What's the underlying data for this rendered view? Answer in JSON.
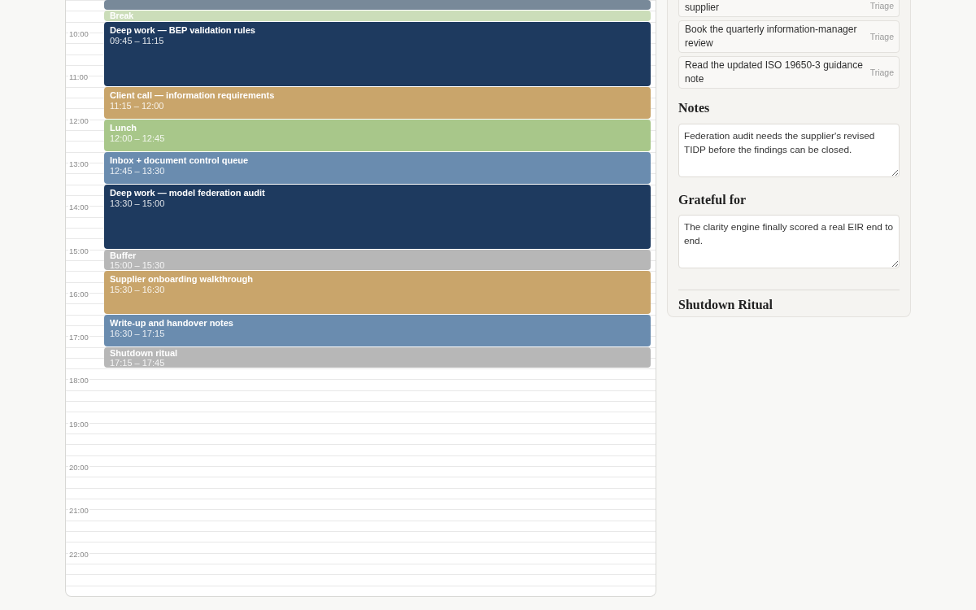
{
  "calendar": {
    "hours": [
      "10:00",
      "11:00",
      "12:00",
      "13:00",
      "14:00",
      "15:00",
      "16:00",
      "17:00",
      "18:00",
      "19:00",
      "20:00",
      "21:00",
      "22:00"
    ],
    "events": [
      {
        "color": "#788999"
      },
      {
        "title": "Break",
        "color": "#cbddb9"
      },
      {
        "title": "Deep work — BEP validation rules",
        "time": "09:45 – 11:15",
        "color": "#1e3a5f"
      },
      {
        "title": "Client call — information requirements",
        "time": "11:15 – 12:00",
        "color": "#c9a56b"
      },
      {
        "title": "Lunch",
        "time": "12:00 – 12:45",
        "color": "#a8c78a"
      },
      {
        "title": "Inbox + document control queue",
        "time": "12:45 – 13:30",
        "color": "#6a8caf"
      },
      {
        "title": "Deep work — model federation audit",
        "time": "13:30 – 15:00",
        "color": "#1e3a5f"
      },
      {
        "title": "Buffer",
        "time": "15:00 – 15:30",
        "color": "#b7b7b7"
      },
      {
        "title": "Supplier onboarding walkthrough",
        "time": "15:30 – 16:30",
        "color": "#c9a56b"
      },
      {
        "title": "Write-up and handover notes",
        "time": "16:30 – 17:15",
        "color": "#6a8caf"
      },
      {
        "title": "Shutdown ritual",
        "time": "17:15 – 17:45",
        "color": "#b7b7b7"
      }
    ]
  },
  "tasks": [
    {
      "text": "supplier",
      "tag": "Triage"
    },
    {
      "text": "Book the quarterly information-manager review",
      "tag": "Triage"
    },
    {
      "text": "Read the updated ISO 19650-3 guidance note",
      "tag": "Triage"
    }
  ],
  "notes": {
    "heading": "Notes",
    "value": "Federation audit needs the supplier's revised TIDP before the findings can be closed."
  },
  "grateful": {
    "heading": "Grateful for",
    "value": "The clarity engine finally scored a real EIR end to end."
  },
  "shutdown": {
    "heading": "Shutdown Ritual"
  }
}
